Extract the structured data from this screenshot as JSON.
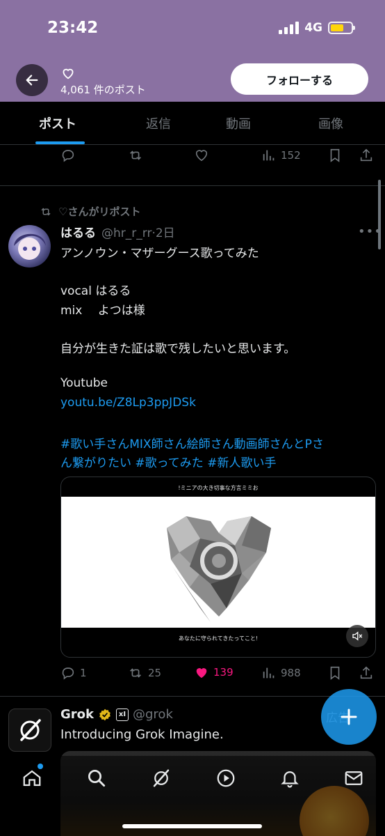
{
  "status_bar": {
    "time": "23:42",
    "network": "4G"
  },
  "header": {
    "post_count": "4,061 件のポスト",
    "follow_label": "フォローする"
  },
  "tabs": [
    {
      "label": "ポスト",
      "active": true
    },
    {
      "label": "返信"
    },
    {
      "label": "動画"
    },
    {
      "label": "画像"
    }
  ],
  "prev_post": {
    "views": "152"
  },
  "post": {
    "repost_label": "♡さんがリポスト",
    "name": "はるる",
    "handle": "@hr_r_rr",
    "time": "·2日",
    "lines": [
      "アンノウン・マザーグース歌ってみた",
      "vocal はるる",
      "mix　 よつは様",
      "自分が生きた証は歌で残したいと思います。",
      "Youtube",
      "youtu.be/Z8Lp3ppJDSk",
      "#歌い手さんMIX師さん絵師さん動画師さんとPさ",
      "ん繋がりたい #歌ってみた #新人歌い手"
    ],
    "media_top_caption": "!ミニアの大き切事な方言ミミお",
    "media_bottom_caption": "あなたに守られてきたってこと!",
    "replies": "1",
    "reposts": "25",
    "likes": "139",
    "views": "988"
  },
  "ad": {
    "name": "Grok",
    "badge": "xI",
    "handle": "@grok",
    "text": "Introducing Grok Imagine.",
    "label": "広告"
  },
  "colors": {
    "accent": "#1d9bf0",
    "like": "#f91880",
    "header_bg": "#8a71a2"
  }
}
